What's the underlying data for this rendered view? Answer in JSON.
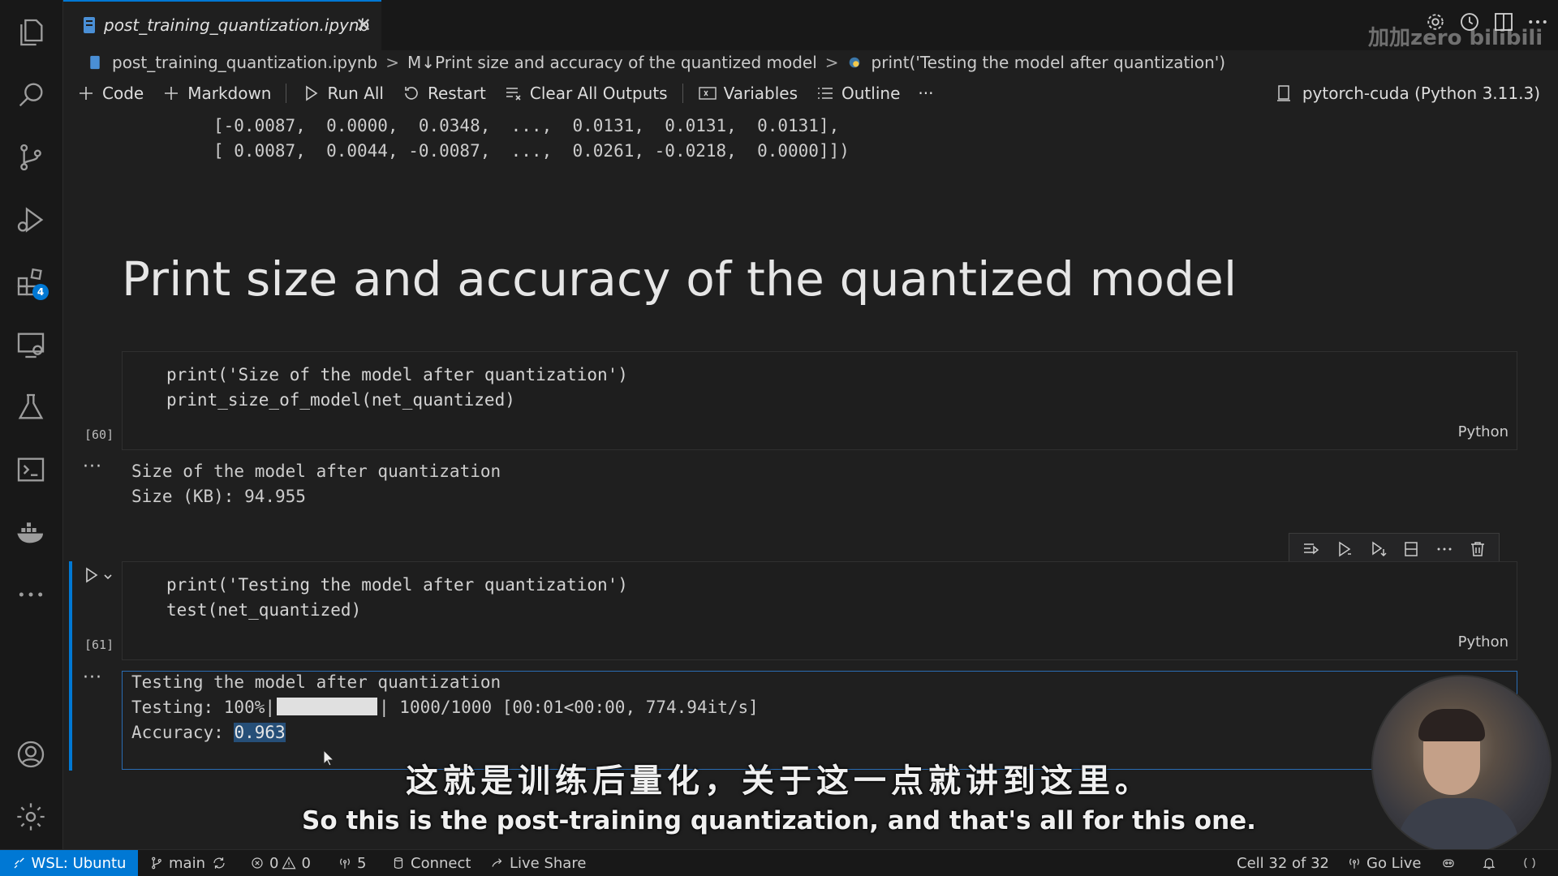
{
  "tab": {
    "title": "post_training_quantization.ipynb",
    "close_glyph": "✕"
  },
  "watermark": "加加zero bilibili",
  "breadcrumb": [
    "post_training_quantization.ipynb",
    "M↓Print size and accuracy of the quantized model",
    "print('Testing the model after quantization')"
  ],
  "toolbar": {
    "code": "Code",
    "markdown": "Markdown",
    "run_all": "Run All",
    "restart": "Restart",
    "clear_outputs": "Clear All Outputs",
    "variables": "Variables",
    "outline": "Outline",
    "more": "···",
    "kernel": "pytorch-cuda (Python 3.11.3)"
  },
  "previous_output": {
    "lines": [
      "[-0.0087,  0.0000,  0.0348,  ...,  0.0131,  0.0131,  0.0131],",
      "[ 0.0087,  0.0044, -0.0087,  ...,  0.0261, -0.0218,  0.0000]])"
    ]
  },
  "markdown_heading": "Print size and accuracy of the quantized model",
  "cells": [
    {
      "exec_count": "[60]",
      "language": "Python",
      "code": [
        "print('Size of the model after quantization')",
        "print_size_of_model(net_quantized)"
      ],
      "output_marker": "···",
      "output": [
        "Size of the model after quantization",
        "Size (KB): 94.955"
      ]
    },
    {
      "exec_count": "[61]",
      "language": "Python",
      "code": [
        "print('Testing the model after quantization')",
        "test(net_quantized)"
      ],
      "output_marker": "···",
      "output_line1": "Testing the model after quantization",
      "progress": {
        "prefix": "Testing: 100%|",
        "fill_fraction": 1.0,
        "suffix": "| 1000/1000 [00:01<00:00, 774.94it/s]"
      },
      "accuracy_label": "Accuracy: ",
      "accuracy_value": "0.963"
    }
  ],
  "subtitles": {
    "zh": "这就是训练后量化，关于这一点就讲到这里。",
    "en": "So this is the post-training quantization, and that's all for this one."
  },
  "status_bar": {
    "remote": "WSL: Ubuntu",
    "branch": "main",
    "errors": "0",
    "warnings": "0",
    "ports": "5",
    "connect": "Connect",
    "live_share": "Live Share",
    "cell_position": "Cell 32 of 32",
    "go_live": "Go Live"
  },
  "activity_bar": {
    "extensions_badge": "4"
  },
  "colors": {
    "accent": "#0078d4",
    "background": "#1f1f1f",
    "sidebar": "#181818"
  }
}
